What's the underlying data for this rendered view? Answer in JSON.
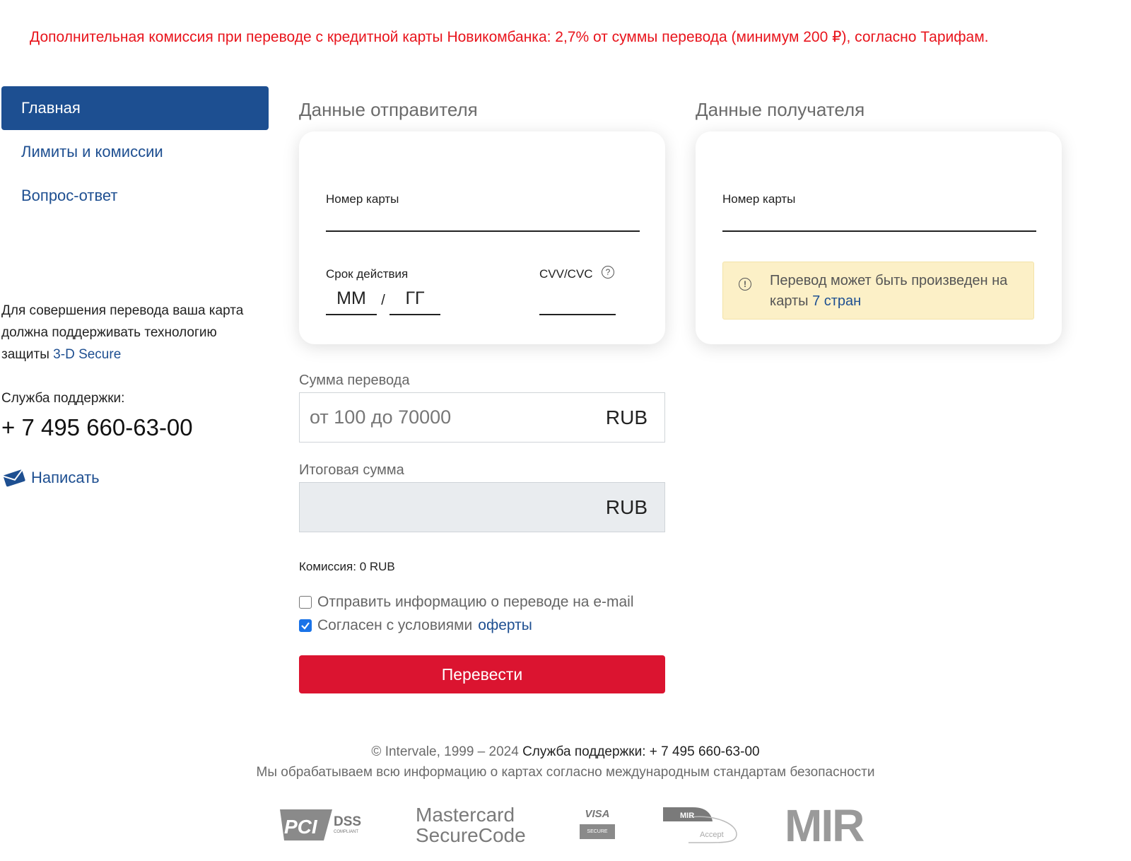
{
  "notice": "Дополнительная комиссия при переводе с кредитной карты Новикомбанка: 2,7% от суммы перевода (минимум 200 ₽), согласно Тарифам.",
  "nav": [
    {
      "label": "Главная",
      "active": true
    },
    {
      "label": "Лимиты и комиссии",
      "active": false
    },
    {
      "label": "Вопрос-ответ",
      "active": false
    }
  ],
  "side": {
    "info_text": "Для совершения перевода ваша карта должна поддерживать технологию защиты",
    "info_link": "3-D Secure",
    "support_label": "Служба поддержки:",
    "support_phone": "+ 7 495 660-63-00",
    "write_label": "Написать"
  },
  "sender": {
    "title": "Данные отправителя",
    "card_number_label": "Номер карты",
    "expiry_label": "Срок действия",
    "month_placeholder": "ММ",
    "separator": "/",
    "year_placeholder": "ГГ",
    "cvv_label": "CVV/CVC",
    "help_symbol": "?"
  },
  "recipient": {
    "title": "Данные получателя",
    "card_number_label": "Номер карты",
    "info_symbol": "!",
    "info_text": "Перевод может быть произведен на карты",
    "info_link": "7 стран"
  },
  "amount": {
    "label": "Сумма перевода",
    "placeholder": "от 100 до 70000",
    "currency": "RUB"
  },
  "total": {
    "label": "Итоговая сумма",
    "value": "",
    "currency": "RUB"
  },
  "commission": "Комиссия: 0 RUB",
  "options": {
    "email_label": "Отправить информацию о переводе на e-mail",
    "email_checked": false,
    "terms_label": "Согласен с условиями",
    "terms_link": "оферты",
    "terms_checked": true
  },
  "submit_label": "Перевести",
  "footer": {
    "copyright": "© Intervale, 1999 – 2024",
    "support": "Служба поддержки: + 7 495 660-63-00",
    "security_note": "Мы обрабатываем всю информацию о картах согласно международным стандартам безопасности",
    "logos": {
      "pci": {
        "main": "PCI",
        "dss": "DSS",
        "compliant": "COMPLIANT"
      },
      "mastercard": {
        "line1": "Mastercard",
        "line2": "SecureCode"
      },
      "visa": {
        "top": "VISA",
        "bottom": "SECURE"
      },
      "mir_accept": {
        "top": "MIR",
        "bottom": "Accept"
      },
      "mir": "MIR"
    }
  },
  "colors": {
    "notice": "#e8141c",
    "primary": "#1d4f91",
    "submit": "#db1430",
    "info_box": "#fcf0c7"
  }
}
